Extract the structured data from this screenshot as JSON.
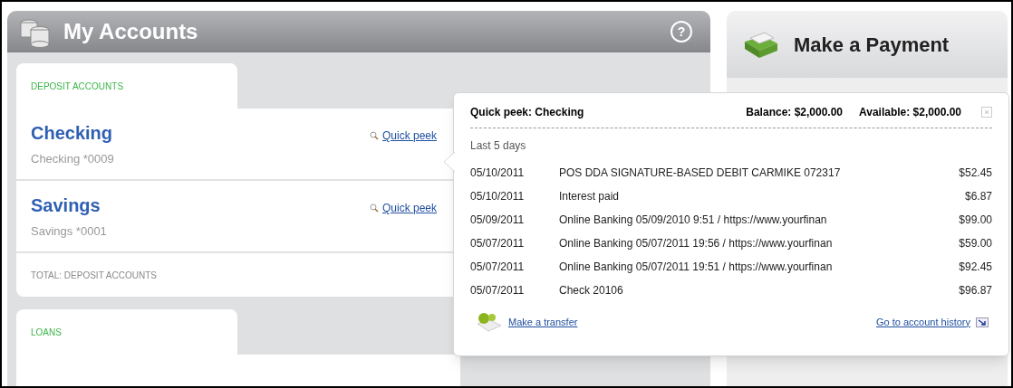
{
  "accounts_panel": {
    "title": "My Accounts",
    "help": "?",
    "sections": [
      {
        "label": "DEPOSIT ACCOUNTS",
        "accounts": [
          {
            "name": "Checking",
            "number": "Checking *0009",
            "link": "Quick peek"
          },
          {
            "name": "Savings",
            "number": "Savings *0001",
            "link": "Quick peek"
          }
        ],
        "total": "TOTAL: DEPOSIT ACCOUNTS"
      },
      {
        "label": "LOANS"
      }
    ]
  },
  "payment_panel": {
    "title": "Make a Payment"
  },
  "quick_peek": {
    "title": "Quick peek: Checking",
    "balance": "Balance: $2,000.00",
    "available": "Available: $2,000.00",
    "period": "Last 5 days",
    "transactions": [
      {
        "date": "05/10/2011",
        "description": "POS DDA SIGNATURE-BASED DEBIT CARMIKE 072317",
        "amount": "$52.45"
      },
      {
        "date": "05/10/2011",
        "description": "Interest paid",
        "amount": "$6.87"
      },
      {
        "date": "05/09/2011",
        "description": "Online Banking  05/09/2010  9:51 / https://www.yourfinan",
        "amount": "$99.00"
      },
      {
        "date": "05/07/2011",
        "description": "Online Banking  05/07/2011 19:56 / https://www.yourfinan",
        "amount": "$59.00"
      },
      {
        "date": "05/07/2011",
        "description": "Online Banking  05/07/2011 19:51 / https://www.yourfinan",
        "amount": "$92.45"
      },
      {
        "date": "05/07/2011",
        "description": "Check 20106",
        "amount": "$96.87"
      }
    ],
    "transfer_link": "Make a transfer",
    "history_link": "Go to account history"
  }
}
